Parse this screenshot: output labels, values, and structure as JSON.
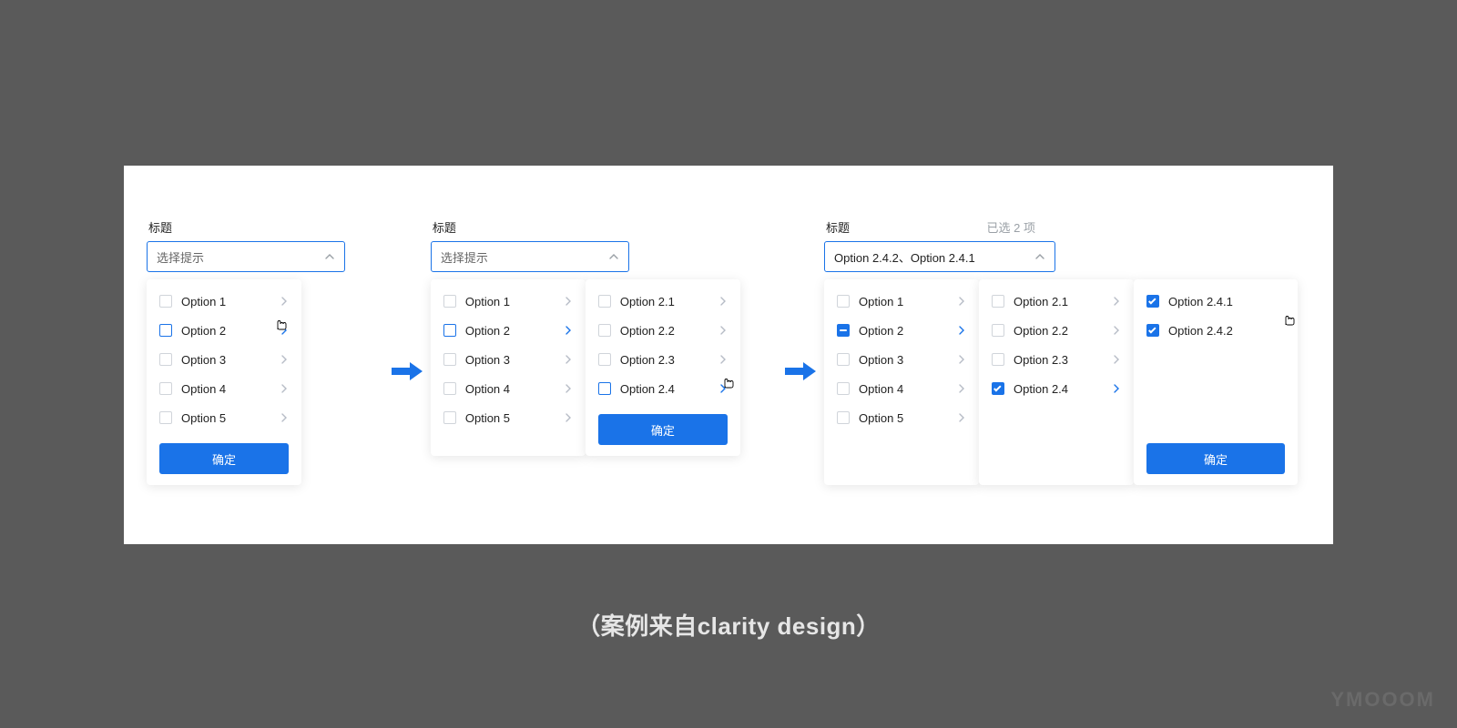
{
  "caption": "（案例来自clarity design）",
  "watermark": "YMOOOM",
  "confirm_label": "确定",
  "title_label": "标题",
  "placeholder": "选择提示",
  "stage1": {
    "options": [
      "Option 1",
      "Option 2",
      "Option 3",
      "Option 4",
      "Option 5"
    ]
  },
  "stage2": {
    "col1": [
      "Option 1",
      "Option 2",
      "Option 3",
      "Option 4",
      "Option 5"
    ],
    "col2": [
      "Option 2.1",
      "Option 2.2",
      "Option 2.3",
      "Option 2.4"
    ]
  },
  "stage3": {
    "selected_text": "Option 2.4.2、Option 2.4.1",
    "count_text": "已选 2 项",
    "col1": [
      "Option 1",
      "Option 2",
      "Option 3",
      "Option 4",
      "Option 5"
    ],
    "col2": [
      "Option 2.1",
      "Option 2.2",
      "Option 2.3",
      "Option 2.4"
    ],
    "col3": [
      "Option 2.4.1",
      "Option 2.4.2"
    ]
  }
}
